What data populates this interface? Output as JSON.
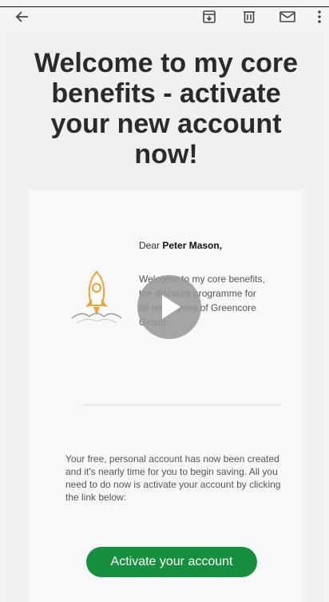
{
  "email": {
    "heading": "Welcome to my core benefits - activate your new account now!",
    "greeting_prefix": "Dear",
    "recipient_name": "Peter Mason,",
    "intro": "Welcome to my core benefits, the discount programme for all employees of Greencore Group.",
    "body": "Your free, personal account has now been created and it's nearly time for you to begin saving. All you need to do now is activate your account by clicking the link below:",
    "cta_label": "Activate your account"
  },
  "toolbar": {
    "back_icon": "arrow-left-icon",
    "archive_icon": "archive-icon",
    "delete_icon": "trash-icon",
    "mark_unread_icon": "mail-icon",
    "more_icon": "more-vertical-icon"
  },
  "colors": {
    "cta_background": "#168f3e",
    "heading_text": "#2a2a2a",
    "rocket_accent": "#f0a030"
  }
}
